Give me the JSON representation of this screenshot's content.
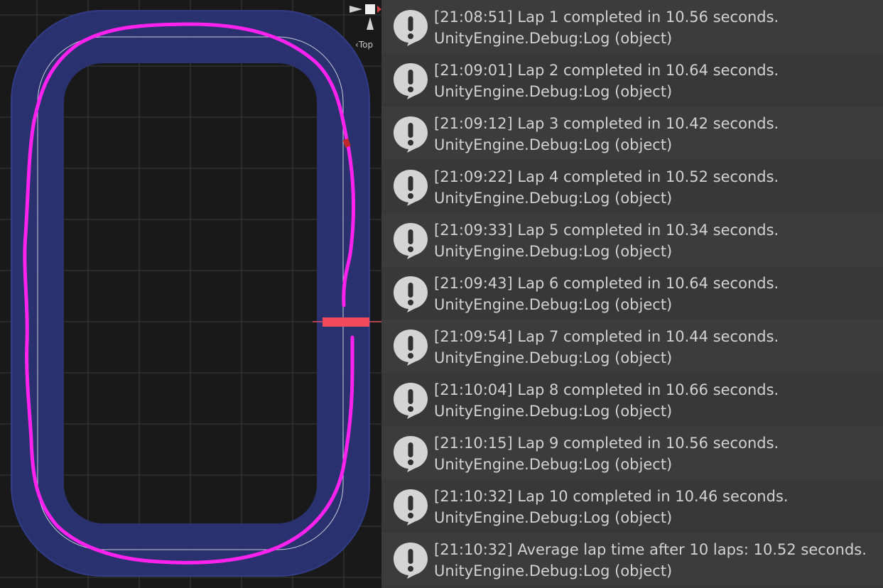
{
  "scene_view": {
    "gizmo_label": "Top",
    "colors": {
      "background": "#191919",
      "grid": "#3a3a3a",
      "track": "#2a3372",
      "track_edge": "#323c86",
      "centerline": "#e8e8f0",
      "path": "#ff22ee",
      "start_line": "#f04a5c"
    }
  },
  "console": {
    "icon": "warning-speech-bubble-icon",
    "entries": [
      {
        "message": "[21:08:51] Lap 1 completed in 10.56 seconds.",
        "source": "UnityEngine.Debug:Log (object)"
      },
      {
        "message": "[21:09:01] Lap 2 completed in 10.64 seconds.",
        "source": "UnityEngine.Debug:Log (object)"
      },
      {
        "message": "[21:09:12] Lap 3 completed in 10.42 seconds.",
        "source": "UnityEngine.Debug:Log (object)"
      },
      {
        "message": "[21:09:22] Lap 4 completed in 10.52 seconds.",
        "source": "UnityEngine.Debug:Log (object)"
      },
      {
        "message": "[21:09:33] Lap 5 completed in 10.34 seconds.",
        "source": "UnityEngine.Debug:Log (object)"
      },
      {
        "message": "[21:09:43] Lap 6 completed in 10.64 seconds.",
        "source": "UnityEngine.Debug:Log (object)"
      },
      {
        "message": "[21:09:54] Lap 7 completed in 10.44 seconds.",
        "source": "UnityEngine.Debug:Log (object)"
      },
      {
        "message": "[21:10:04] Lap 8 completed in 10.66 seconds.",
        "source": "UnityEngine.Debug:Log (object)"
      },
      {
        "message": "[21:10:15] Lap 9 completed in 10.56 seconds.",
        "source": "UnityEngine.Debug:Log (object)"
      },
      {
        "message": "[21:10:32] Lap 10 completed in 10.46 seconds.",
        "source": "UnityEngine.Debug:Log (object)"
      },
      {
        "message": "[21:10:32] Average lap time after 10 laps: 10.52 seconds.",
        "source": "UnityEngine.Debug:Log (object)"
      }
    ]
  }
}
